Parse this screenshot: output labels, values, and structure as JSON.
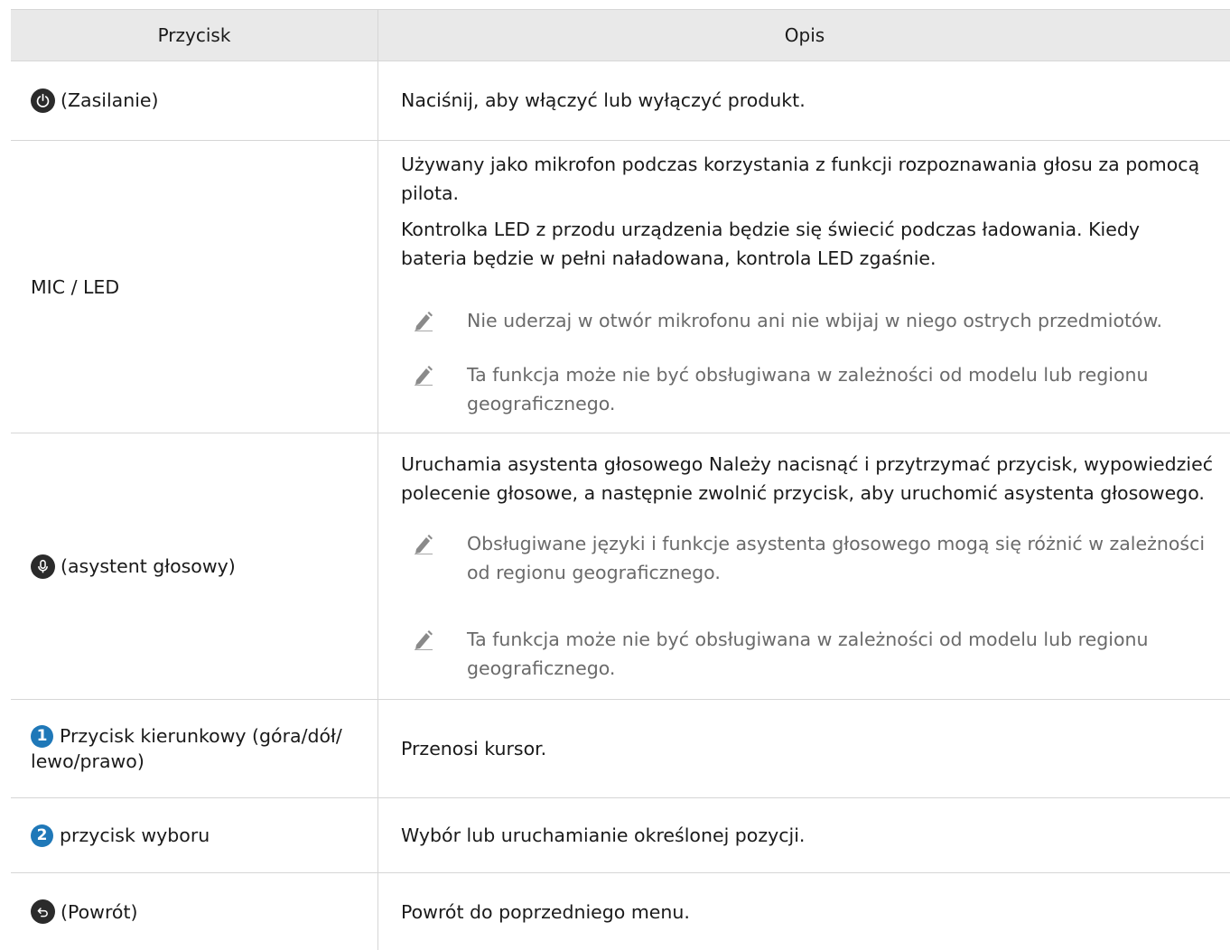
{
  "header": {
    "col1": "Przycisk",
    "col2": "Opis"
  },
  "rows": [
    {
      "icon": "power-icon",
      "button": "(Zasilanie)",
      "description": "Naciśnij, aby włączyć lub wyłączyć produkt."
    },
    {
      "button": "MIC / LED",
      "paragraphs": [
        "Używany jako mikrofon podczas korzystania z funkcji rozpoznawania głosu za pomocą",
        "pilota.",
        "Kontrolka LED z przodu urządzenia będzie się świecić podczas ładowania. Kiedy",
        "bateria będzie w pełni naładowana, kontrola LED zgaśnie."
      ],
      "notes": [
        [
          "Nie uderzaj w otwór mikrofonu ani nie wbijaj w niego ostrych przedmiotów."
        ],
        [
          "Ta funkcja może nie być obsługiwana w zależności od modelu lub regionu",
          "geograficznego."
        ]
      ]
    },
    {
      "icon": "microphone-icon",
      "button": "(asystent głosowy)",
      "paragraphs": [
        "Uruchamia asystenta głosowego Należy nacisnąć i przytrzymać przycisk, wypowiedzieć",
        "polecenie głosowe, a następnie zwolnić przycisk, aby uruchomić asystenta głosowego."
      ],
      "notes": [
        [
          "Obsługiwane języki i funkcje asystenta głosowego mogą się różnić w zależności",
          "od regionu geograficznego."
        ],
        [
          "Ta funkcja może nie być obsługiwana w zależności od modelu lub regionu",
          "geograficznego."
        ]
      ]
    },
    {
      "number": "1",
      "button_line1": "Przycisk kierunkowy (góra/dół/",
      "button_line2": "lewo/prawo)",
      "description": "Przenosi kursor."
    },
    {
      "number": "2",
      "button": "przycisk wyboru",
      "description": "Wybór lub uruchamianie określonej pozycji."
    },
    {
      "icon": "return-icon",
      "button": "(Powrót)",
      "description": "Powrót do poprzedniego menu."
    }
  ],
  "colors": {
    "header_bg": "#e9e9e9",
    "border": "#d6d6d6",
    "number_badge": "#1f78b8",
    "note_text": "#6a6a6a"
  }
}
